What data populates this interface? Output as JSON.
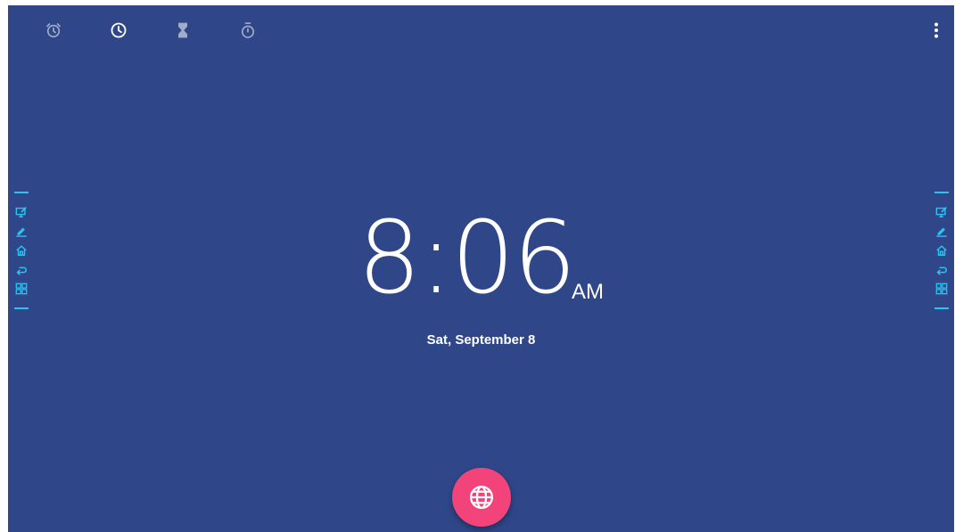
{
  "tabs": [
    {
      "name": "alarm",
      "icon": "alarm-icon",
      "active": false
    },
    {
      "name": "clock",
      "icon": "clock-icon",
      "active": true
    },
    {
      "name": "timer",
      "icon": "hourglass-icon",
      "active": false
    },
    {
      "name": "stopwatch",
      "icon": "stopwatch-icon",
      "active": false
    }
  ],
  "overflow_menu": {
    "icon": "more-vert-icon"
  },
  "side_toolbar": {
    "color": "#29c3f2",
    "items": [
      {
        "icon": "screen-annotate-icon"
      },
      {
        "icon": "pen-icon"
      },
      {
        "icon": "home-icon"
      },
      {
        "icon": "back-icon"
      },
      {
        "icon": "apps-icon"
      }
    ]
  },
  "clock": {
    "time": "8:06",
    "ampm": "AM",
    "date": "Sat, September 8"
  },
  "fab": {
    "icon": "globe-icon",
    "color": "#f2437a"
  },
  "colors": {
    "background": "#2f4789",
    "accent": "#29c3f2",
    "fab": "#f2437a",
    "text": "#ffffff"
  }
}
